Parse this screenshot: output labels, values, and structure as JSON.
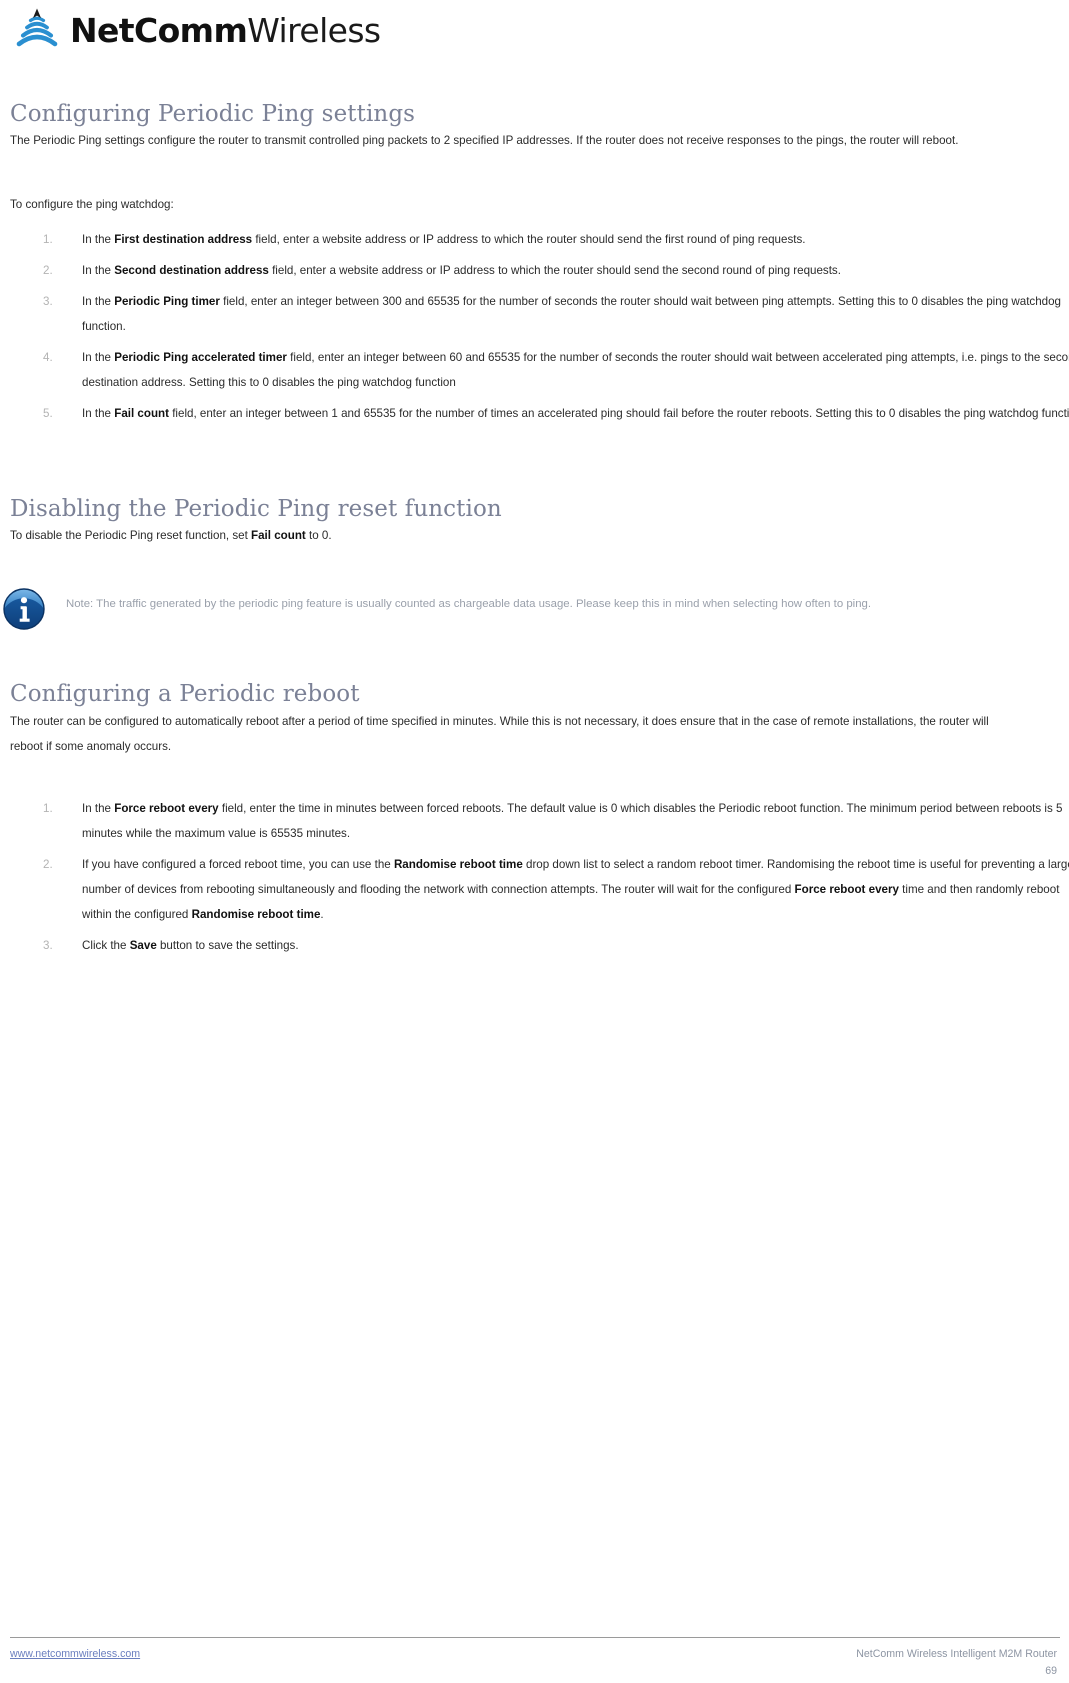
{
  "logo": {
    "mark": "wifi-waves-icon",
    "brand_bold": "NetComm",
    "brand_light": "Wireless",
    "accent_color": "#2a8fd0"
  },
  "sections": {
    "ping": {
      "heading": "Configuring Periodic Ping settings",
      "intro": "The Periodic Ping settings configure the router to transmit controlled ping packets to 2 specified IP addresses. If the router does not receive responses to the pings, the router will reboot.",
      "lead_in": "To configure the ping watchdog:",
      "steps": [
        {
          "number": "1.",
          "pre": "In the ",
          "strong": "First destination address",
          "post": " field, enter a website address or IP address to which the router should send the first round of ping requests."
        },
        {
          "number": "2.",
          "pre": "In the ",
          "strong": "Second destination address",
          "post": " field, enter a website address or IP address to which the router should send the second round of ping requests."
        },
        {
          "number": "3.",
          "pre": "In the ",
          "strong": "Periodic Ping timer",
          "post": " field, enter an integer between 300 and 65535 for the number of seconds the router should wait between ping attempts. Setting this to 0 disables the ping watchdog function."
        },
        {
          "number": "4.",
          "pre": "In the ",
          "strong": "Periodic Ping accelerated timer",
          "post": " field, enter an integer between 60 and 65535 for the number of seconds the router should wait between accelerated ping attempts, i.e. pings to the second destination address. Setting this to 0 disables the ping watchdog function"
        },
        {
          "number": "5.",
          "pre": "In the ",
          "strong": "Fail count",
          "post": " field, enter an integer between 1 and 65535 for the number of times an accelerated ping should fail before the router reboots. Setting this to 0 disables the ping watchdog function."
        }
      ]
    },
    "disabling": {
      "heading": "Disabling the Periodic Ping reset function",
      "body_pre": "To disable the Periodic Ping reset function, set ",
      "body_strong": "Fail count",
      "body_post": " to 0."
    },
    "note": {
      "icon": "info-icon",
      "text": "Note: The traffic generated by the periodic ping feature is usually counted as chargeable data usage. Please keep this in mind when selecting how often to ping."
    },
    "reboot": {
      "heading": "Configuring a Periodic reboot",
      "intro": "The router can be configured to automatically reboot after a period of time specified in minutes. While this is not necessary, it does ensure that in the case of remote installations, the router will reboot if some anomaly occurs.",
      "steps": [
        {
          "number": "1.",
          "pre": "In the ",
          "strong": "Force reboot every",
          "post": " field, enter the time in minutes between forced reboots. The default value is 0 which disables the Periodic reboot function. The minimum period between reboots is 5 minutes while the maximum value is 65535 minutes."
        },
        {
          "number": "2.",
          "pre": "If you have configured a forced reboot time, you can use the ",
          "strong": "Randomise reboot time",
          "post": " drop down list to select a random reboot timer. Randomising the reboot time is useful for preventing a large number of devices from rebooting simultaneously and flooding the network with connection attempts. The router will wait for the configured ",
          "strong2": "Force reboot every",
          "post2": " time and then randomly reboot within the configured ",
          "strong3": "Randomise reboot time",
          "post3": "."
        },
        {
          "number": "3.",
          "pre": "Click the ",
          "strong": "Save",
          "post": " button to save the settings."
        }
      ]
    }
  },
  "footer": {
    "website": "www.netcommwireless.com",
    "product": "NetComm Wireless Intelligent M2M Router",
    "page_number": "69"
  }
}
